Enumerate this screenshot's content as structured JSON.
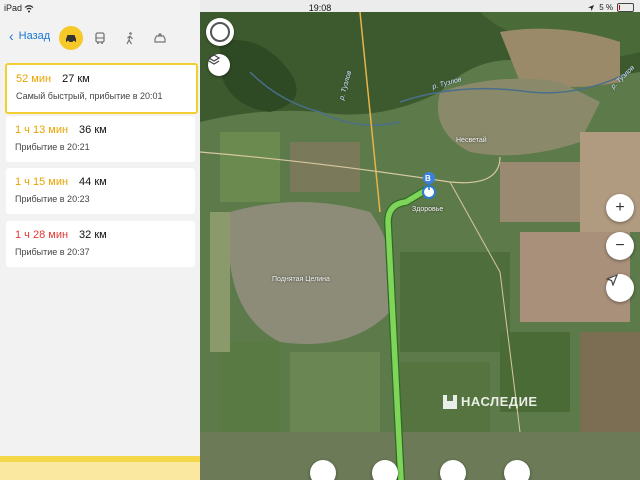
{
  "status_bar": {
    "device": "iPad",
    "time": "19:08",
    "battery": "5 %"
  },
  "nav": {
    "back_label": "Назад",
    "modes": [
      {
        "icon": "car-icon",
        "active": true
      },
      {
        "icon": "bus-icon",
        "active": false
      },
      {
        "icon": "walk-icon",
        "active": false
      },
      {
        "icon": "taxi-icon",
        "active": false
      }
    ]
  },
  "routes": [
    {
      "time": "52 мин",
      "distance": "27 км",
      "subtitle": "Самый быстрый, прибытие в 20:01",
      "time_color": "#e8a400"
    },
    {
      "time": "1 ч 13 мин",
      "distance": "36 км",
      "subtitle": "Прибытие в 20:21",
      "time_color": "#e8a400"
    },
    {
      "time": "1 ч 15 мин",
      "distance": "44 км",
      "subtitle": "Прибытие в 20:23",
      "time_color": "#e8a400"
    },
    {
      "time": "1 ч 28 мин",
      "distance": "32 км",
      "subtitle": "Прибытие в 20:37",
      "time_color": "#e53935"
    }
  ],
  "map": {
    "labels": {
      "river1": "р. Тузлов",
      "river2": "р. Тузлов",
      "river3": "р. Тузлов",
      "village1": "Несветай",
      "village2": "Здоровье",
      "village3": "Поднятая Целина"
    },
    "destination_marker": "B",
    "watermark": "НАСЛЕДИЕ",
    "route_color": "#6cc84a"
  }
}
